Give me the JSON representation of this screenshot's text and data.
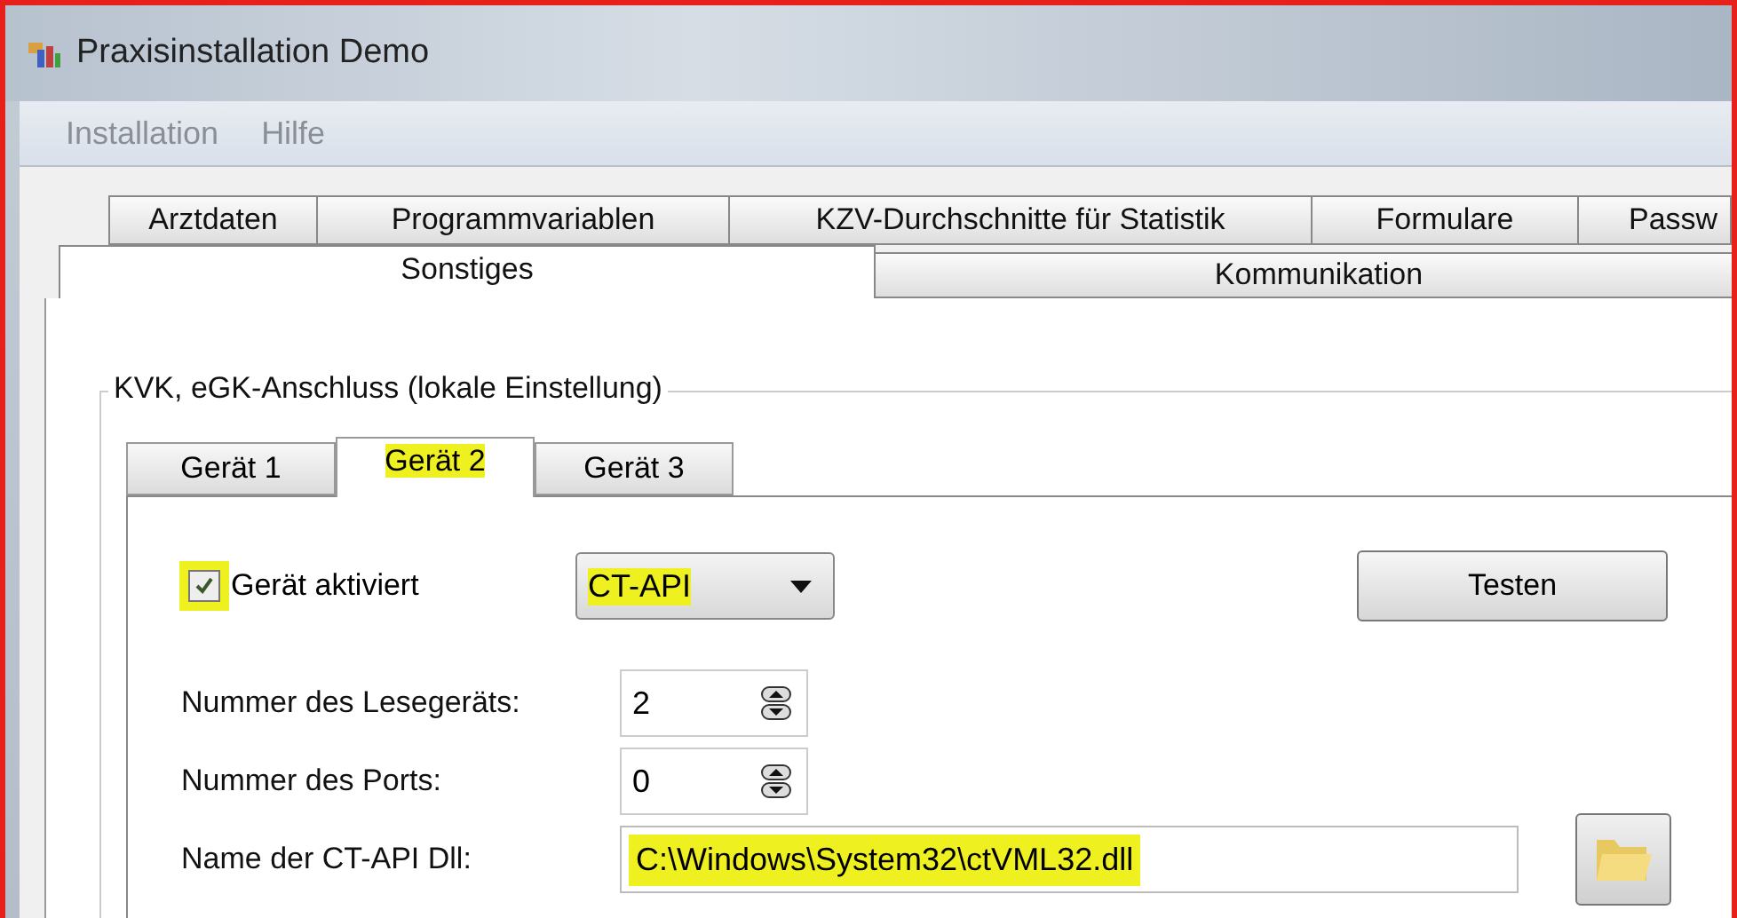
{
  "window": {
    "title": "Praxisinstallation Demo"
  },
  "menu": [
    {
      "label": "Installation"
    },
    {
      "label": "Hilfe"
    }
  ],
  "tab_rows": [
    [
      {
        "label": "Arztdaten",
        "selected": false
      },
      {
        "label": "Programmvariablen",
        "selected": false
      },
      {
        "label": "KZV-Durchschnitte für Statistik",
        "selected": false
      },
      {
        "label": "Formulare",
        "selected": false
      },
      {
        "label": "Passw",
        "selected": false
      }
    ],
    [
      {
        "label": "Sonstiges",
        "selected": true
      },
      {
        "label": "Kommunikation",
        "selected": false
      }
    ]
  ],
  "group": {
    "title": "KVK, eGK-Anschluss (lokale Einstellung)"
  },
  "device_tabs": [
    {
      "label": "Gerät 1",
      "selected": false,
      "highlighted": false
    },
    {
      "label": "Gerät 2",
      "selected": true,
      "highlighted": true
    },
    {
      "label": "Gerät 3",
      "selected": false,
      "highlighted": false
    }
  ],
  "activated": {
    "label": "Gerät aktiviert",
    "checked": true,
    "highlighted": true
  },
  "interface": {
    "value": "CT-API",
    "highlighted": true
  },
  "test_button": "Testen",
  "fields": [
    {
      "kind": "spin",
      "label": "Nummer des Lesegeräts:",
      "value": "2",
      "highlighted": false
    },
    {
      "kind": "spin",
      "label": "Nummer des Ports:",
      "value": "0",
      "highlighted": false
    },
    {
      "kind": "path",
      "label": "Name der CT-API Dll:",
      "value": "C:\\Windows\\System32\\ctVML32.dll",
      "highlighted": true
    }
  ]
}
